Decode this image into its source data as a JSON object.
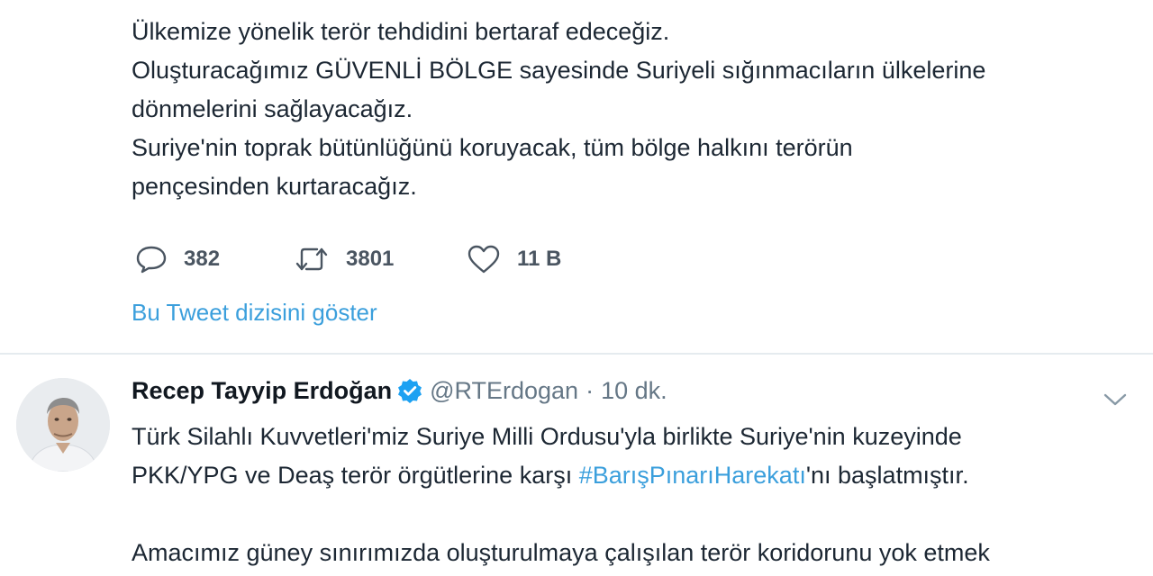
{
  "tweet_top": {
    "lines": [
      "Ülkemize yönelik terör tehdidini bertaraf edeceğiz.",
      "Oluşturacağımız GÜVENLİ BÖLGE sayesinde Suriyeli sığınmacıların ülkelerine",
      "dönmelerini sağlayacağız.",
      "Suriye'nin toprak bütünlüğünü koruyacak, tüm bölge halkını terörün",
      "pençesinden kurtaracağız."
    ],
    "actions": {
      "reply_icon": "reply-icon",
      "reply_count": "382",
      "retweet_icon": "retweet-icon",
      "retweet_count": "3801",
      "like_icon": "heart-icon",
      "like_count": "11 B"
    },
    "show_thread_label": "Bu Tweet dizisini göster"
  },
  "tweet_main": {
    "author_name": "Recep Tayyip Erdoğan",
    "verified_icon": "verified-badge-icon",
    "handle": "@RTErdogan",
    "separator": "·",
    "time": "10 dk.",
    "menu_icon": "chevron-down-icon",
    "line1": "Türk Silahlı Kuvvetleri'miz Suriye Milli Ordusu'yla birlikte Suriye'nin kuzeyinde",
    "line2_before": "PKK/YPG ve Deaş terör örgütlerine karşı ",
    "hashtag": "#BarışPınarıHarekatı",
    "line2_after": "'nı başlatmıştır.",
    "line3": "Amacımız güney sınırımızda oluşturulmaya çalışılan terör koridorunu yok etmek"
  },
  "colors": {
    "link": "#3b9fdc",
    "verified": "#1da1f2",
    "text": "#1c2733",
    "muted": "#657786",
    "divider": "#e5ebef"
  }
}
